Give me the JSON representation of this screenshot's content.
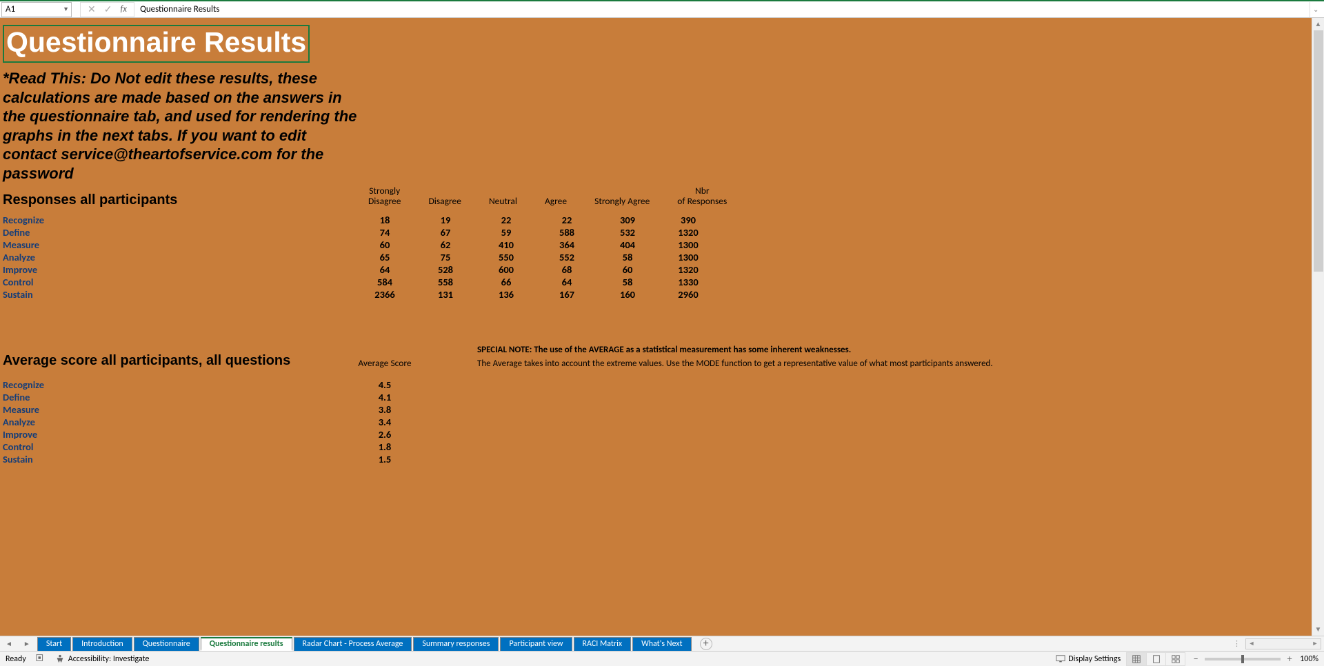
{
  "formula_bar": {
    "cell_ref": "A1",
    "value": "Questionnaire Results"
  },
  "content": {
    "title": "Questionnaire Results",
    "read_this": "*Read This: Do Not edit these results, these calculations are made based on the answers in the questionnaire tab, and used for rendering the graphs in the next tabs. If you want to edit contact service@theartofservice.com for the password",
    "section1_header": "Responses all participants",
    "columns": [
      "Strongly Disagree",
      "Disagree",
      "Neutral",
      "Agree",
      "Strongly Agree",
      "Nbr of Responses"
    ],
    "rows": [
      {
        "label": "Recognize",
        "v": [
          "18",
          "19",
          "22",
          "22",
          "309",
          "390"
        ]
      },
      {
        "label": "Define",
        "v": [
          "74",
          "67",
          "59",
          "588",
          "532",
          "1320"
        ]
      },
      {
        "label": "Measure",
        "v": [
          "60",
          "62",
          "410",
          "364",
          "404",
          "1300"
        ]
      },
      {
        "label": "Analyze",
        "v": [
          "65",
          "75",
          "550",
          "552",
          "58",
          "1300"
        ]
      },
      {
        "label": "Improve",
        "v": [
          "64",
          "528",
          "600",
          "68",
          "60",
          "1320"
        ]
      },
      {
        "label": "Control",
        "v": [
          "584",
          "558",
          "66",
          "64",
          "58",
          "1330"
        ]
      },
      {
        "label": "Sustain",
        "v": [
          "2366",
          "131",
          "136",
          "167",
          "160",
          "2960"
        ]
      }
    ],
    "section2_header": "Average score all participants, all questions",
    "avg_col_header": "Average Score",
    "avg_rows": [
      {
        "label": "Recognize",
        "v": "4.5"
      },
      {
        "label": "Define",
        "v": "4.1"
      },
      {
        "label": "Measure",
        "v": "3.8"
      },
      {
        "label": "Analyze",
        "v": "3.4"
      },
      {
        "label": "Improve",
        "v": "2.6"
      },
      {
        "label": "Control",
        "v": "1.8"
      },
      {
        "label": "Sustain",
        "v": "1.5"
      }
    ],
    "special_note_1": "SPECIAL NOTE: The use of the AVERAGE as a statistical measurement has some inherent weaknesses.",
    "special_note_2": "The Average takes into account the extreme values. Use the MODE function to get a representative value of what most participants answered."
  },
  "tabs": {
    "items": [
      "Start",
      "Introduction",
      "Questionnaire",
      "Questionnaire results",
      "Radar Chart - Process Average",
      "Summary responses",
      "Participant view",
      "RACI Matrix",
      "What's Next"
    ],
    "active_index": 3
  },
  "status": {
    "ready": "Ready",
    "accessibility": "Accessibility: Investigate",
    "display_settings": "Display Settings",
    "zoom": "100%"
  }
}
